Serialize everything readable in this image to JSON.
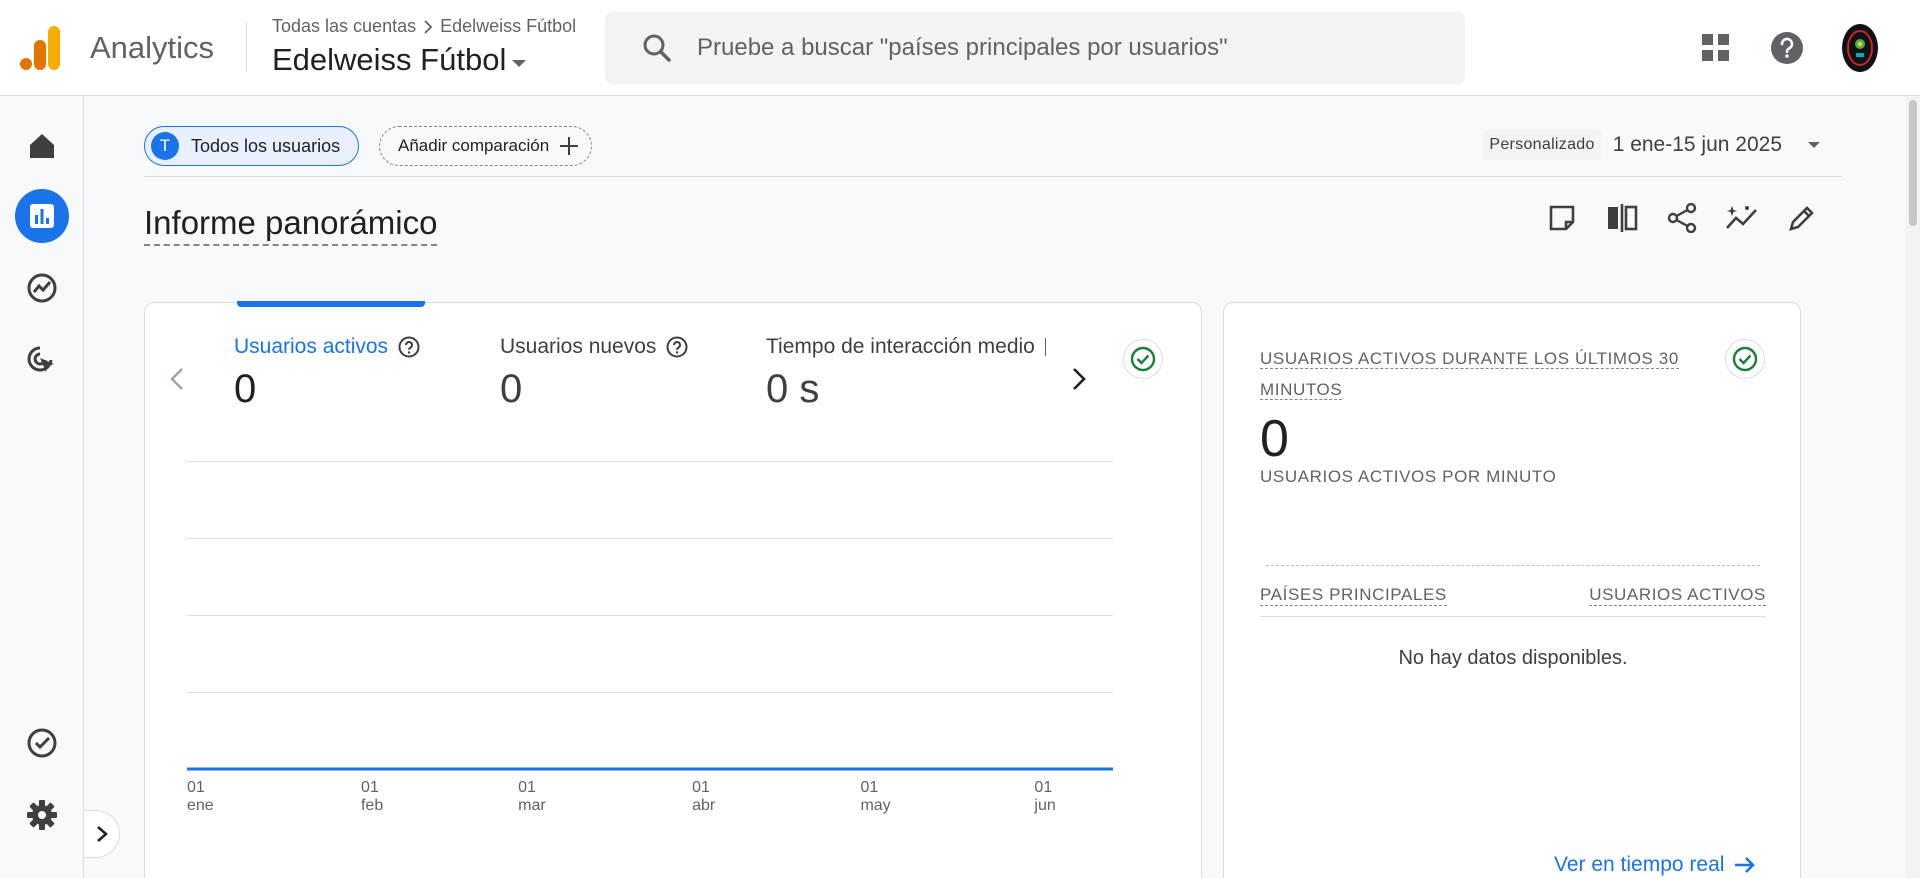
{
  "app": {
    "name": "Analytics"
  },
  "breadcrumb": {
    "root": "Todas las cuentas",
    "account": "Edelweiss Fútbol"
  },
  "property": {
    "name": "Edelweiss Fútbol"
  },
  "search": {
    "placeholder": "Pruebe a buscar \"países principales por usuarios\""
  },
  "topbar_icons": [
    "apps-grid-icon",
    "help-icon",
    "account-avatar"
  ],
  "rail": {
    "items": [
      "home-icon",
      "reports-icon",
      "explore-icon",
      "advertising-icon"
    ],
    "bottom": [
      "admin-check-icon",
      "settings-gear-icon"
    ],
    "active": "reports-icon"
  },
  "filters": {
    "segment_initial": "T",
    "segment_label": "Todos los usuarios",
    "add_comparison": "Añadir comparación"
  },
  "date": {
    "tag": "Personalizado",
    "range": "1 ene-15 jun 2025"
  },
  "page": {
    "title": "Informe panorámico"
  },
  "toolbar_icons": [
    "note-icon",
    "compare-columns-icon",
    "share-icon",
    "insights-icon",
    "edit-pencil-icon"
  ],
  "metrics": [
    {
      "label": "Usuarios activos",
      "value": "0"
    },
    {
      "label": "Usuarios nuevos",
      "value": "0"
    },
    {
      "label": "Tiempo de interacción medio",
      "value": "0 s"
    }
  ],
  "chart_data": {
    "type": "line",
    "x": [
      {
        "day": "01",
        "month": "ene"
      },
      {
        "day": "01",
        "month": "feb"
      },
      {
        "day": "01",
        "month": "mar"
      },
      {
        "day": "01",
        "month": "abr"
      },
      {
        "day": "01",
        "month": "may"
      },
      {
        "day": "01",
        "month": "jun"
      }
    ],
    "x_dates": [
      "2025-01-01",
      "2025-02-01",
      "2025-03-01",
      "2025-04-01",
      "2025-05-01",
      "2025-06-01"
    ],
    "x_range": [
      "2025-01-01",
      "2025-06-15"
    ],
    "series": [
      {
        "values": [
          0,
          0,
          0,
          0,
          0,
          0
        ],
        "color": "#1a73e8"
      }
    ],
    "ylim": [
      0,
      4
    ],
    "grid": true,
    "legend": "none"
  },
  "realtime": {
    "title": "Usuarios activos durante los últimos 30 minutos",
    "value": "0",
    "subtitle": "Usuarios activos por minuto",
    "col_countries": "Países principales",
    "col_users": "Usuarios activos",
    "empty": "No hay datos disponibles.",
    "link": "Ver en tiempo real"
  },
  "colors": {
    "accent": "#1a73e8",
    "success": "#188038",
    "logo_orange": "#f9ab00",
    "logo_dark": "#e37400"
  }
}
